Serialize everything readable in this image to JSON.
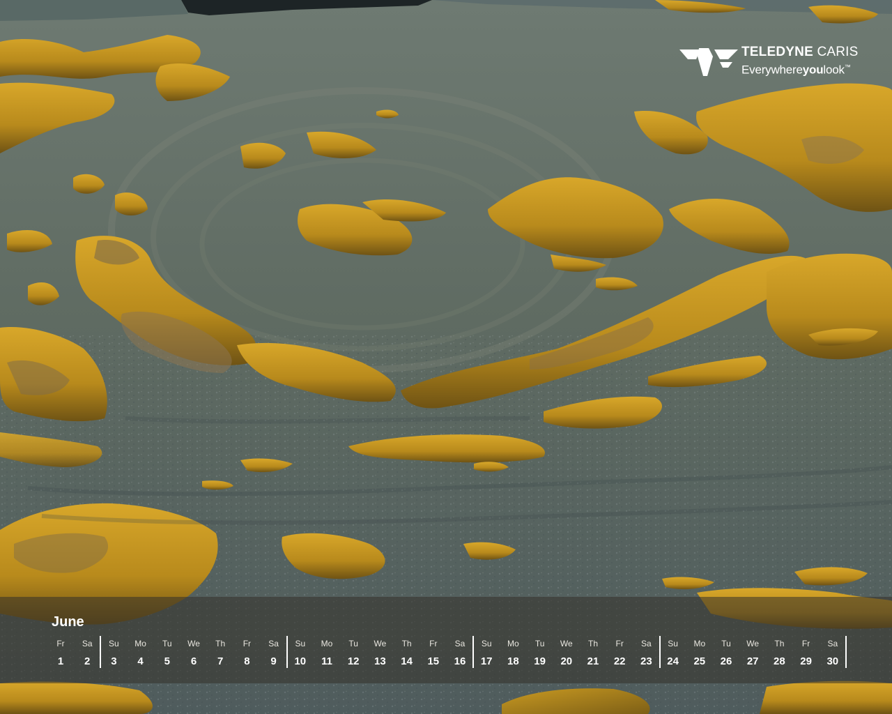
{
  "brand": {
    "name": "TELEDYNE",
    "sub": "CARIS",
    "tagline_start": "Everywhere",
    "tagline_bold": "you",
    "tagline_end": "look",
    "tagline_mark": "™"
  },
  "calendar": {
    "month": "June",
    "days": [
      {
        "dow": "Fr",
        "num": "1"
      },
      {
        "dow": "Sa",
        "num": "2"
      },
      {
        "dow": "Su",
        "num": "3"
      },
      {
        "dow": "Mo",
        "num": "4"
      },
      {
        "dow": "Tu",
        "num": "5"
      },
      {
        "dow": "We",
        "num": "6"
      },
      {
        "dow": "Th",
        "num": "7"
      },
      {
        "dow": "Fr",
        "num": "8"
      },
      {
        "dow": "Sa",
        "num": "9"
      },
      {
        "dow": "Su",
        "num": "10"
      },
      {
        "dow": "Mo",
        "num": "11"
      },
      {
        "dow": "Tu",
        "num": "12"
      },
      {
        "dow": "We",
        "num": "13"
      },
      {
        "dow": "Th",
        "num": "14"
      },
      {
        "dow": "Fr",
        "num": "15"
      },
      {
        "dow": "Sa",
        "num": "16"
      },
      {
        "dow": "Su",
        "num": "17"
      },
      {
        "dow": "Mo",
        "num": "18"
      },
      {
        "dow": "Tu",
        "num": "19"
      },
      {
        "dow": "We",
        "num": "20"
      },
      {
        "dow": "Th",
        "num": "21"
      },
      {
        "dow": "Fr",
        "num": "22"
      },
      {
        "dow": "Sa",
        "num": "23"
      },
      {
        "dow": "Su",
        "num": "24"
      },
      {
        "dow": "Mo",
        "num": "25"
      },
      {
        "dow": "Tu",
        "num": "26"
      },
      {
        "dow": "We",
        "num": "27"
      },
      {
        "dow": "Th",
        "num": "28"
      },
      {
        "dow": "Fr",
        "num": "29"
      },
      {
        "dow": "Sa",
        "num": "30"
      }
    ]
  },
  "colors": {
    "seabed": "#5e6a63",
    "ridge": "#c6961f",
    "ridge_shadow": "#7a5c14",
    "text": "#ffffff"
  }
}
